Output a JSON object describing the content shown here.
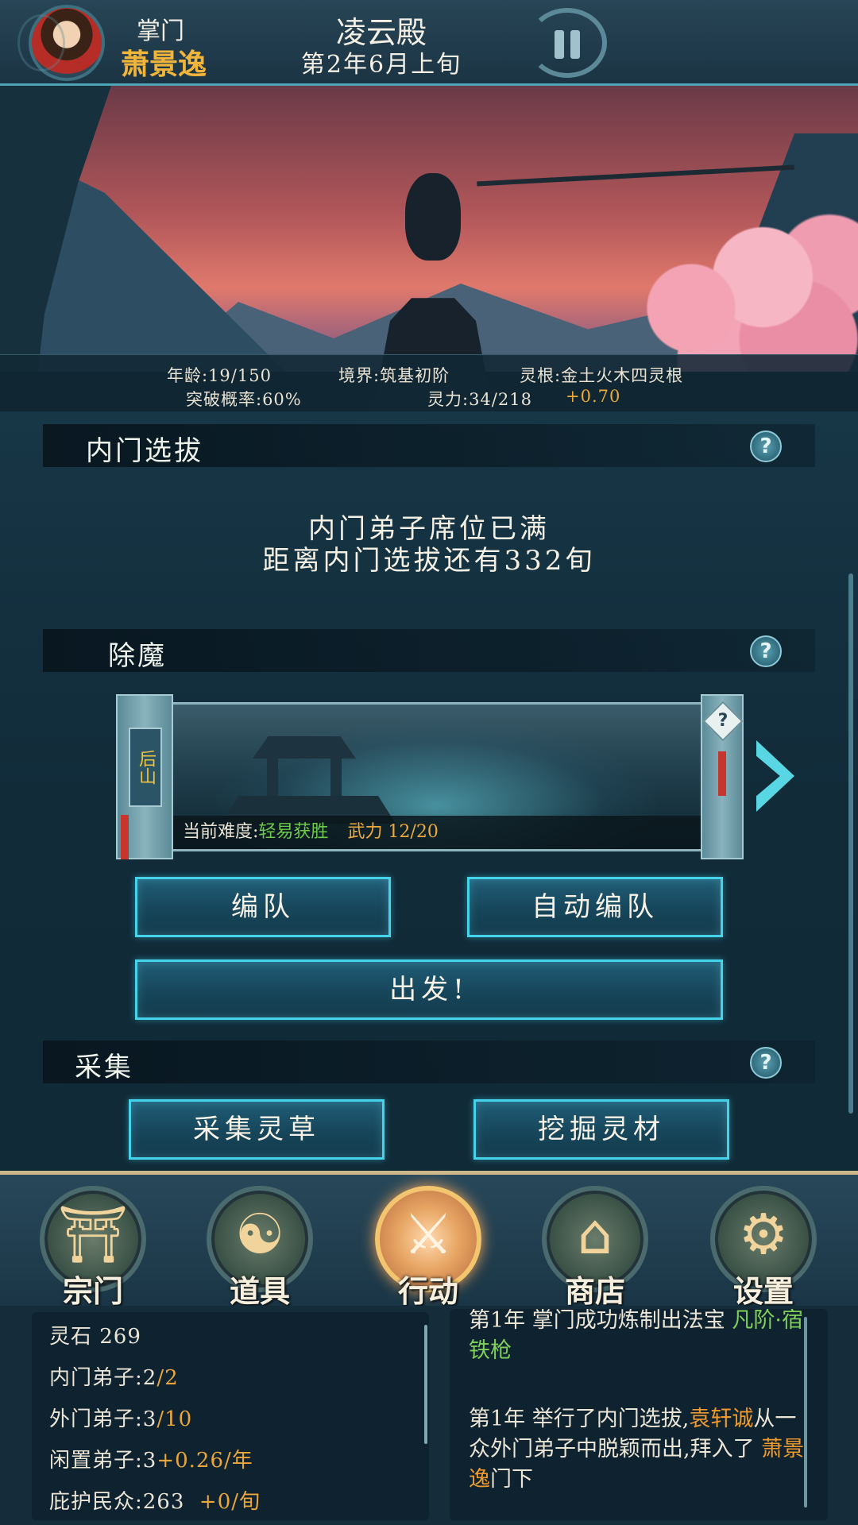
{
  "header": {
    "role_label": "掌门",
    "leader_name": "萧景逸",
    "hall_name": "凌云殿",
    "date": "第2年6月上旬"
  },
  "stats": {
    "age": "年龄:19/150",
    "realm": "境界:筑基初阶",
    "root": "灵根:金土火木四灵根",
    "breakthrough": "突破概率:60%",
    "spirit_power": "灵力:34/218",
    "spirit_rate": "+0.70"
  },
  "sections": {
    "inner_selection": {
      "title": "内门选拔",
      "line1": "内门弟子席位已满",
      "line2": "距离内门选拔还有332旬"
    },
    "demon_slaying": {
      "title": "除魔",
      "location": "后山",
      "difficulty_label": "当前难度:",
      "difficulty_value": "轻易获胜",
      "power": "武力 12/20",
      "mystery_mark": "?",
      "btn_team": "编队",
      "btn_auto_team": "自动编队",
      "btn_depart": "出发!"
    },
    "gathering": {
      "title": "采集",
      "btn_herbs": "采集灵草",
      "btn_dig": "挖掘灵材"
    },
    "help_mark": "?"
  },
  "nav": {
    "items": [
      {
        "label": "宗门",
        "icon": "sect-gate-icon",
        "glyph": "⛩"
      },
      {
        "label": "道具",
        "icon": "item-bag-icon",
        "glyph": "☯"
      },
      {
        "label": "行动",
        "icon": "action-sword-icon",
        "glyph": "⚔"
      },
      {
        "label": "商店",
        "icon": "shop-icon",
        "glyph": "⌂"
      },
      {
        "label": "设置",
        "icon": "settings-gear-icon",
        "glyph": "⚙"
      }
    ],
    "active_index": 2
  },
  "resources": {
    "spirit_stones": "灵石 269",
    "inner_disciples": "内门弟子:2",
    "inner_cap": "/2",
    "outer_disciples": "外门弟子:3",
    "outer_cap": "/10",
    "idle_disciples": "闲置弟子:3",
    "idle_rate": "+0.26/年",
    "protected_people": "庇护民众:263",
    "protected_rate": "+0/旬"
  },
  "log": {
    "entry1_text": "第1年 掌门成功炼制出法宝",
    "entry1_item": "凡阶·宿铁枪",
    "entry2_a": "第1年 举行了内门选拔,",
    "entry2_name": "袁轩诚",
    "entry2_b": "从一众外门弟子中脱颖而出,拜入了",
    "entry2_master": "萧景逸",
    "entry2_c": "门下"
  },
  "colors": {
    "accent_cyan": "#44d3ea",
    "gold_text": "#f2b53c",
    "green_text": "#6cc94a",
    "orange_text": "#eda93a",
    "panel_bg": "#112b39"
  }
}
